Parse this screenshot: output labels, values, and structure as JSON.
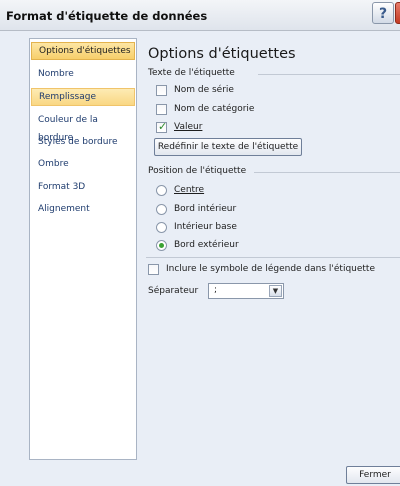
{
  "window": {
    "title": "Format d'étiquette de données",
    "help_label": "?"
  },
  "sidebar": {
    "items": [
      {
        "label": "Options d'étiquettes"
      },
      {
        "label": "Nombre"
      },
      {
        "label": "Remplissage"
      },
      {
        "label": "Couleur de la bordure"
      },
      {
        "label": "Styles de bordure"
      },
      {
        "label": "Ombre"
      },
      {
        "label": "Format 3D"
      },
      {
        "label": "Alignement"
      }
    ]
  },
  "panel": {
    "title": "Options d'étiquettes",
    "label_text_group": "Texte de l'étiquette",
    "checkboxes": [
      {
        "label": "Nom de série",
        "checked": false
      },
      {
        "label": "Nom de catégorie",
        "checked": false
      },
      {
        "label": "Valeur",
        "checked": true
      }
    ],
    "reset_button": "Redéfinir le texte de l'étiquette",
    "position_group": "Position de l'étiquette",
    "radios": [
      {
        "label": "Centre",
        "checked": false
      },
      {
        "label": "Bord intérieur",
        "checked": false
      },
      {
        "label": "Intérieur base",
        "checked": false
      },
      {
        "label": "Bord extérieur",
        "checked": true
      }
    ],
    "include_legend": {
      "label": "Inclure le symbole de légende dans l'étiquette",
      "checked": false
    },
    "separator": {
      "label": "Séparateur",
      "value": ";"
    }
  },
  "footer": {
    "close_button": "Fermer"
  }
}
